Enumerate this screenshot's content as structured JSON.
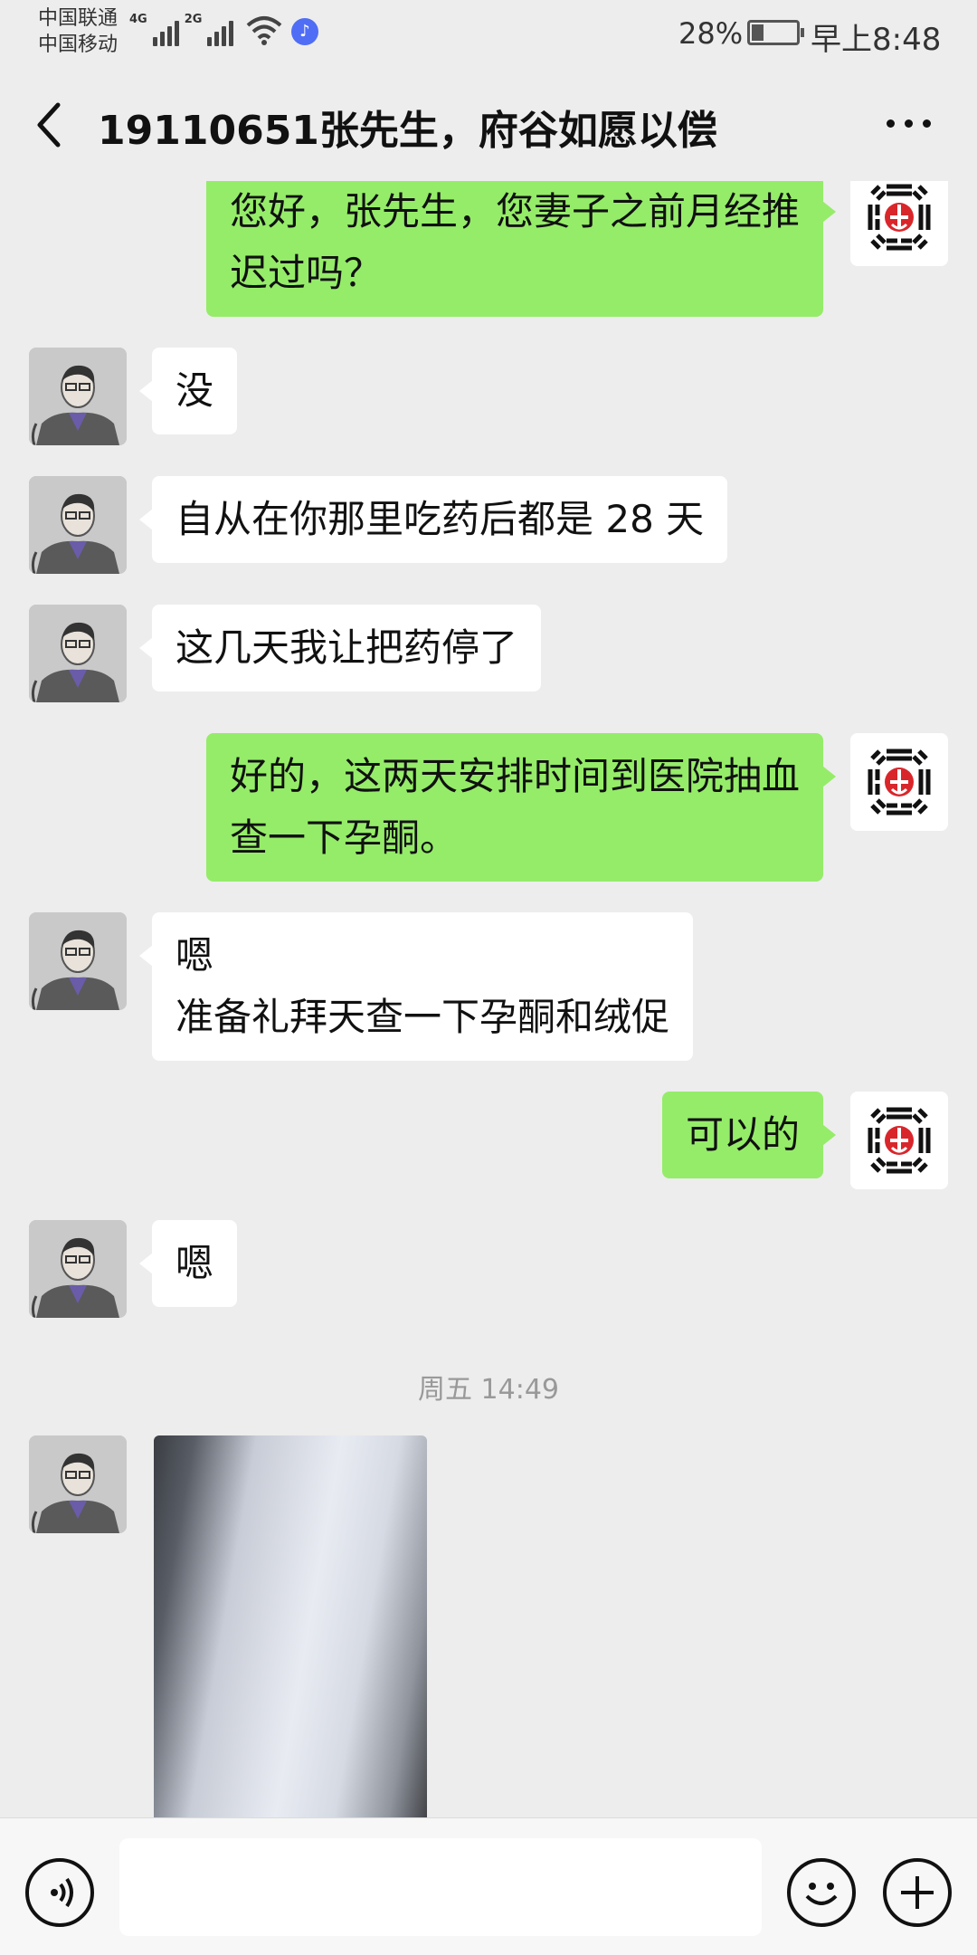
{
  "status_bar": {
    "carrier_1": "中国联通",
    "carrier_2": "中国移动",
    "network_1": "4G",
    "network_2": "2G",
    "battery_text": "28%",
    "battery_level": 0.28,
    "time": "早上8:48",
    "icons": [
      "signal-icon",
      "wifi-icon",
      "music-notification-icon",
      "battery-icon"
    ]
  },
  "header": {
    "title": "19110651张先生，府谷如愿以偿",
    "back_icon": "chevron-left-icon",
    "more_icon": "more-dots-icon"
  },
  "messages": [
    {
      "side": "right",
      "lines": [
        "您好，张先生，您妻子之前月经推",
        "迟过吗？"
      ]
    },
    {
      "side": "left",
      "lines": [
        "没"
      ]
    },
    {
      "side": "left",
      "lines": [
        "自从在你那里吃药后都是 28 天"
      ]
    },
    {
      "side": "left",
      "lines": [
        "这几天我让把药停了"
      ]
    },
    {
      "side": "right",
      "lines": [
        "好的，这两天安排时间到医院抽血",
        "查一下孕酮。"
      ]
    },
    {
      "side": "left",
      "lines": [
        "嗯",
        "准备礼拜天查一下孕酮和绒促"
      ]
    },
    {
      "side": "right",
      "lines": [
        "可以的"
      ]
    },
    {
      "side": "left",
      "lines": [
        "嗯"
      ]
    },
    {
      "type": "timestamp",
      "text": "周五 14:49"
    },
    {
      "side": "left",
      "type": "image"
    }
  ],
  "input_bar": {
    "voice_icon": "voice-icon",
    "emoji_icon": "emoji-icon",
    "plus_icon": "plus-icon",
    "input_value": ""
  },
  "colors": {
    "background": "#ededed",
    "sent_bubble": "#95ec69",
    "received_bubble": "#ffffff",
    "timestamp_text": "#999999"
  }
}
